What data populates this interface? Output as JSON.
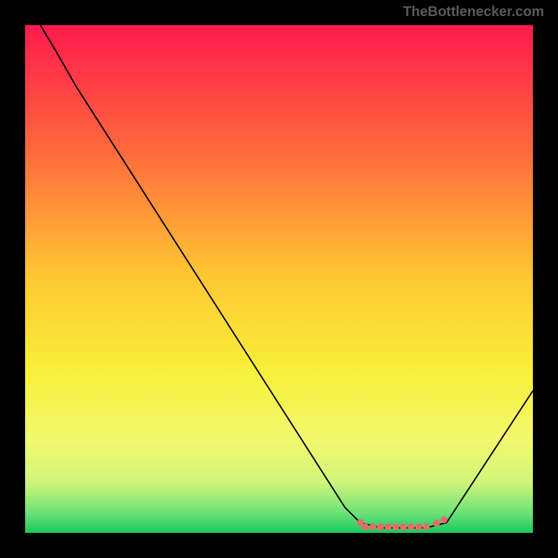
{
  "watermark": "TheBottlenecker.com",
  "chart_data": {
    "type": "line",
    "title": "",
    "xlabel": "",
    "ylabel": "",
    "xlim": [
      0,
      100
    ],
    "ylim": [
      0,
      100
    ],
    "background": {
      "type": "vertical-gradient",
      "stops": [
        {
          "offset": 0,
          "color": "#ff1a4d"
        },
        {
          "offset": 25,
          "color": "#ff6a3c"
        },
        {
          "offset": 50,
          "color": "#ffc933"
        },
        {
          "offset": 68,
          "color": "#f7ef39"
        },
        {
          "offset": 82,
          "color": "#f1f96e"
        },
        {
          "offset": 90,
          "color": "#d0f57a"
        },
        {
          "offset": 96,
          "color": "#6de378"
        },
        {
          "offset": 100,
          "color": "#18c95e"
        }
      ]
    },
    "series": [
      {
        "name": "bottleneck-curve",
        "color": "#000000",
        "points": [
          {
            "x": 3,
            "y": 100
          },
          {
            "x": 6,
            "y": 95
          },
          {
            "x": 10,
            "y": 88
          },
          {
            "x": 63,
            "y": 5
          },
          {
            "x": 66,
            "y": 2
          },
          {
            "x": 70,
            "y": 1
          },
          {
            "x": 79,
            "y": 1
          },
          {
            "x": 83,
            "y": 2
          },
          {
            "x": 100,
            "y": 28
          }
        ]
      }
    ],
    "highlight": {
      "name": "optimal-range",
      "color": "#e86a6a",
      "points_x": [
        66,
        67,
        68.5,
        70,
        71.5,
        73,
        74.5,
        76,
        77.5,
        79,
        81,
        82.5
      ],
      "y": 1.2
    }
  }
}
